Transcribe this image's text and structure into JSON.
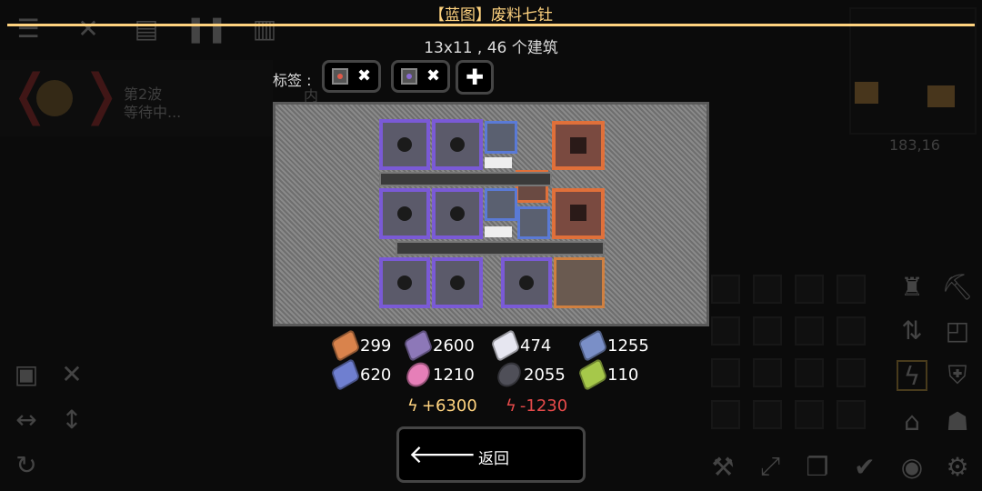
{
  "dialog": {
    "title": "【蓝图】废料七钍",
    "size_text": "13x11 , 46 个建筑",
    "tags_label": "标签 :",
    "back_label": "返回"
  },
  "tags": [
    {
      "icon": "router-block-icon",
      "color": "#e05a4a"
    },
    {
      "icon": "sorter-block-icon",
      "color": "#8a6ad6"
    }
  ],
  "requirements": [
    {
      "item": "copper",
      "icon": "copper-icon",
      "amount": "299",
      "color": "#d9834c"
    },
    {
      "item": "lead",
      "icon": "lead-icon",
      "amount": "2600",
      "color": "#8d78b8"
    },
    {
      "item": "metaglass",
      "icon": "metaglass-icon",
      "amount": "474",
      "color": "#e6e6f0"
    },
    {
      "item": "titanium",
      "icon": "titanium-icon",
      "amount": "1255",
      "color": "#7a8fc7"
    },
    {
      "item": "thorium",
      "icon": "thorium-icon",
      "amount": "620",
      "color": "#6f7fd0"
    },
    {
      "item": "phase-fabric",
      "icon": "spore-pod-icon",
      "amount": "1210",
      "color": "#e67fb8"
    },
    {
      "item": "graphite",
      "icon": "graphite-icon",
      "amount": "2055",
      "color": "#4f4f58"
    },
    {
      "item": "plastanium",
      "icon": "plastanium-icon",
      "amount": "110",
      "color": "#a6c84a"
    }
  ],
  "power": {
    "produced": "+6300",
    "consumed": "-1230",
    "produced_color": "#ffd37f",
    "consumed_color": "#e64a4a"
  },
  "background": {
    "wave_label": "第2波",
    "wave_status": "等待中...",
    "coords": "183,16",
    "hidden_text": "内"
  }
}
